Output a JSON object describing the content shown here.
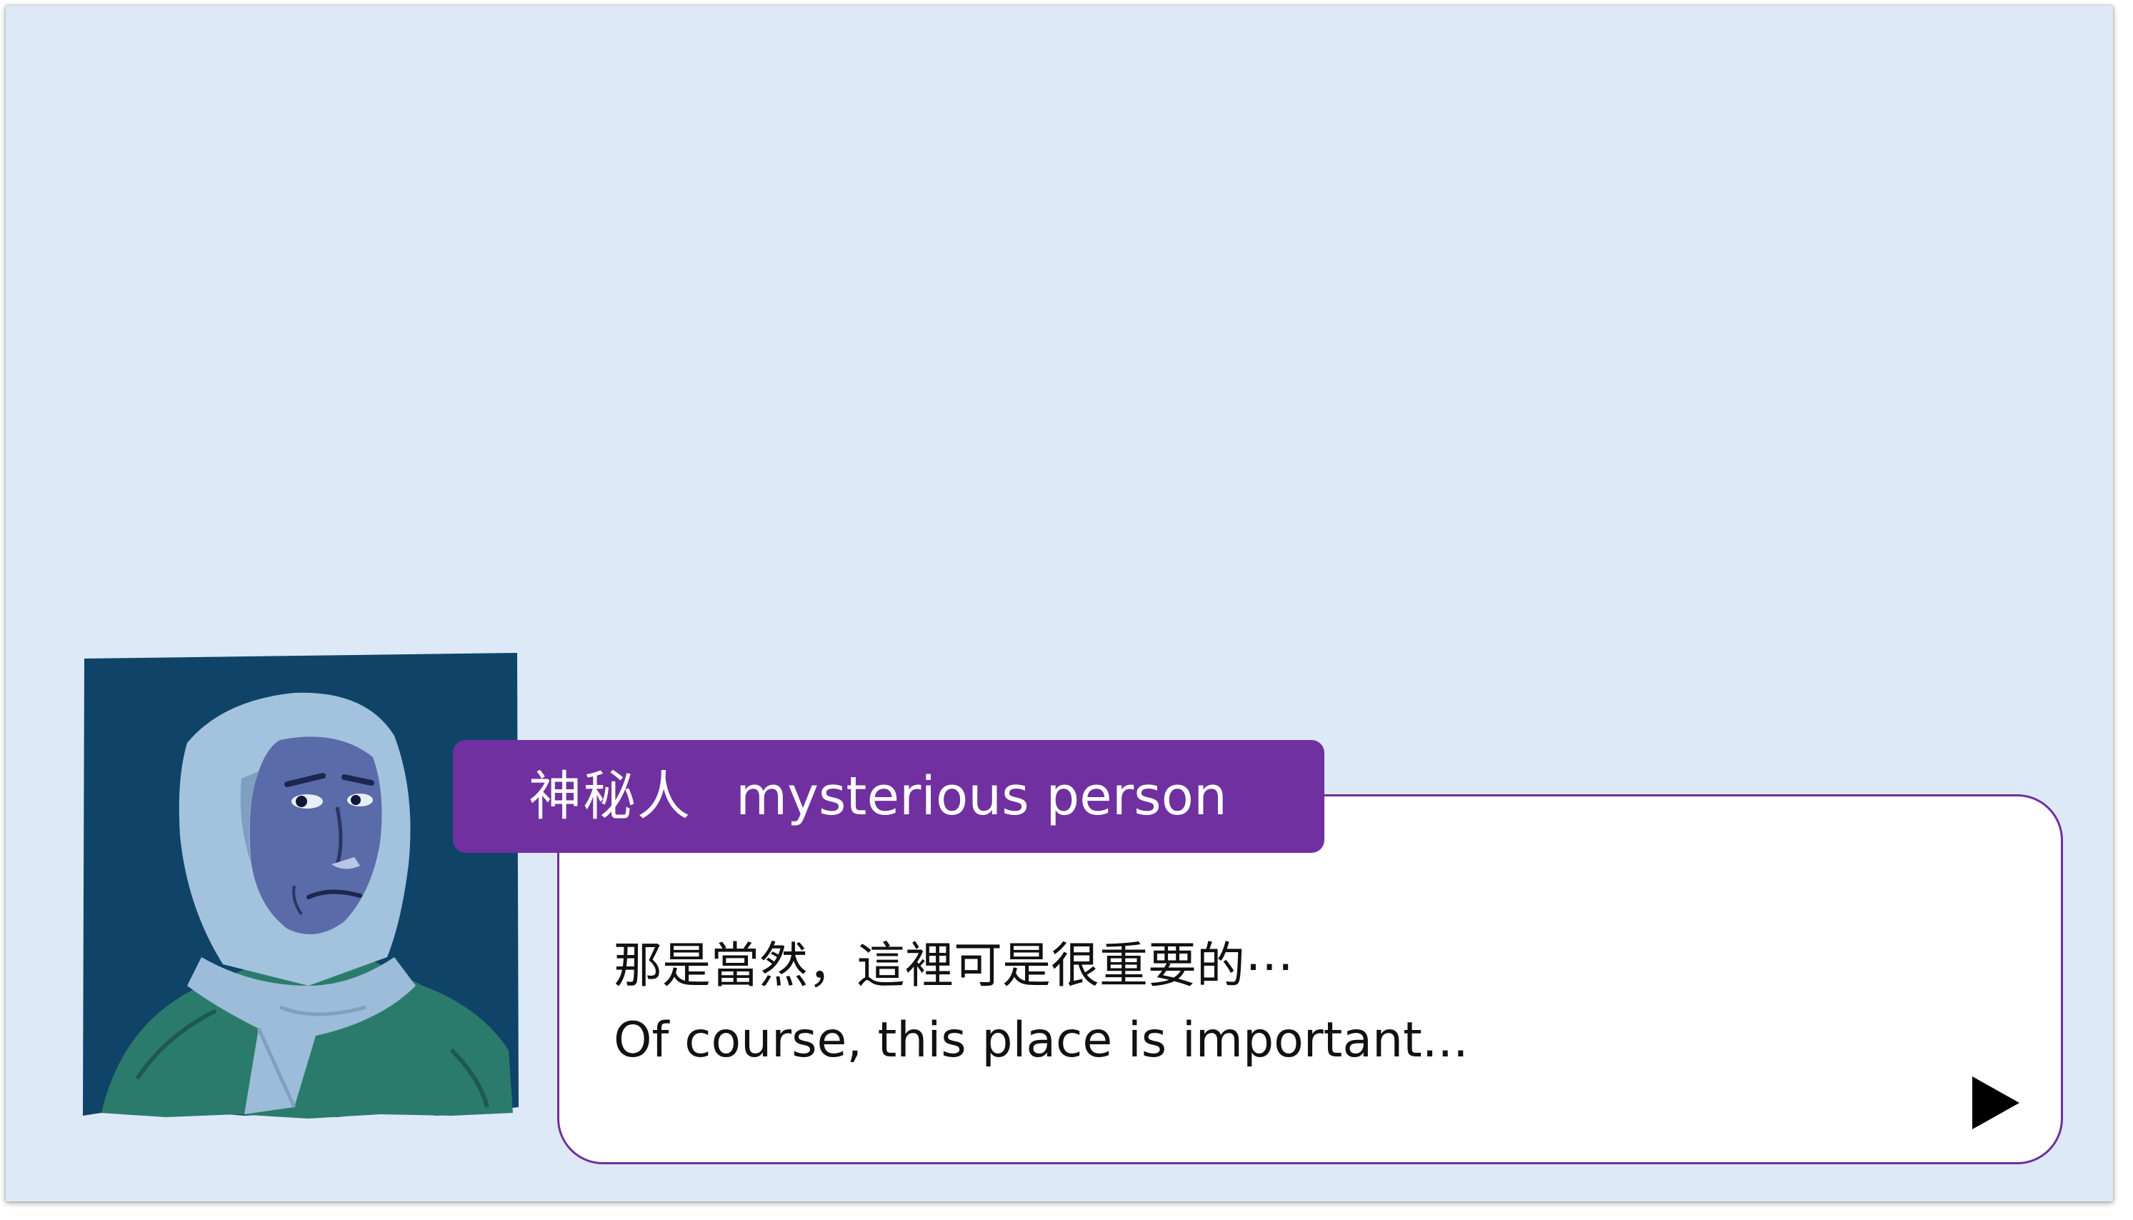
{
  "speaker": {
    "name_zh": "神秘人",
    "name_en": "mysterious person"
  },
  "dialog": {
    "line_zh": "那是當然，這裡可是很重要的⋯",
    "line_en": "Of course, this place is important..."
  },
  "colors": {
    "background": "#dde9f6",
    "name_tag": "#7030a0",
    "dialog_border": "#6f2f9e",
    "portrait_bg": "#0f4468",
    "scarf": "#9fbfdc",
    "face": "#5a6aa8",
    "jacket": "#2a7a6a"
  },
  "icons": {
    "advance": "play-triangle-icon",
    "portrait": "hooded-figure-portrait"
  }
}
